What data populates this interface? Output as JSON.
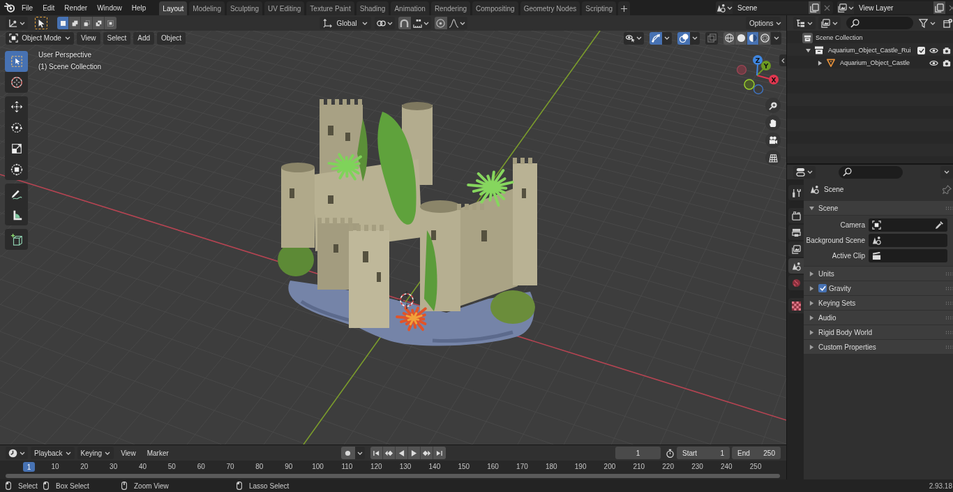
{
  "top_bar": {
    "menus": [
      "File",
      "Edit",
      "Render",
      "Window",
      "Help"
    ],
    "workspaces": [
      {
        "label": "Layout",
        "selected": true
      },
      {
        "label": "Modeling",
        "selected": false
      },
      {
        "label": "Sculpting",
        "selected": false
      },
      {
        "label": "UV Editing",
        "selected": false
      },
      {
        "label": "Texture Paint",
        "selected": false
      },
      {
        "label": "Shading",
        "selected": false
      },
      {
        "label": "Animation",
        "selected": false
      },
      {
        "label": "Rendering",
        "selected": false
      },
      {
        "label": "Compositing",
        "selected": false
      },
      {
        "label": "Geometry Nodes",
        "selected": false
      },
      {
        "label": "Scripting",
        "selected": false
      }
    ],
    "scene": "Scene",
    "view_layer": "View Layer"
  },
  "viewport": {
    "tool_header": {
      "select_modes": [
        {
          "selected": true
        },
        {
          "selected": false
        },
        {
          "selected": false
        },
        {
          "selected": false
        },
        {
          "selected": false
        }
      ],
      "orientation": "Global",
      "snap": {
        "on": false
      },
      "proportional_editing": {
        "on": false
      },
      "options": "Options"
    },
    "header": {
      "mode": "Object Mode",
      "menus": [
        "View",
        "Select",
        "Add",
        "Object"
      ],
      "gizmos": {
        "on": true
      },
      "overlays": {
        "on": true
      },
      "xray": {
        "on": false
      },
      "shading_modes": [
        {
          "selected": false
        },
        {
          "selected": false
        },
        {
          "selected": true
        },
        {
          "selected": false
        }
      ]
    },
    "info": [
      "User Perspective",
      "(1) Scene Collection"
    ],
    "tools": [
      {
        "selected": true
      },
      {
        "selected": false
      },
      {
        "selected": false
      },
      {
        "selected": false
      },
      {
        "selected": false
      },
      {
        "selected": false
      },
      {
        "selected": false
      },
      {
        "selected": false
      },
      {
        "selected": false
      }
    ],
    "gizmo_axes": [
      "X",
      "Y",
      "Z"
    ]
  },
  "outliner": {
    "tree": [
      {
        "kind": "scene_collection",
        "label": "Scene Collection",
        "children": [
          {
            "kind": "collection",
            "label": "Aquarium_Object_Castle_Rui",
            "expanded": true,
            "checked": true,
            "visible": true,
            "renderable": true,
            "children": [
              {
                "kind": "object",
                "label": "Aquarium_Object_Castle",
                "expanded": false,
                "visible": true,
                "renderable": true
              }
            ]
          }
        ]
      }
    ]
  },
  "properties": {
    "tabs": [
      {
        "selected": false
      },
      {
        "selected": false
      },
      {
        "selected": false
      },
      {
        "selected": false
      },
      {
        "selected": true
      },
      {
        "selected": false
      },
      {
        "selected": false
      }
    ],
    "context": "Scene",
    "panels": [
      {
        "title": "Scene",
        "expanded": true,
        "fields": [
          "Camera",
          "Background Scene",
          "Active Clip"
        ]
      },
      {
        "title": "Units",
        "expanded": false
      },
      {
        "title": "Gravity",
        "expanded": false,
        "toggle": {
          "checked": true
        }
      },
      {
        "title": "Keying Sets",
        "expanded": false
      },
      {
        "title": "Audio",
        "expanded": false
      },
      {
        "title": "Rigid Body World",
        "expanded": false
      },
      {
        "title": "Custom Properties",
        "expanded": false
      }
    ]
  },
  "timeline": {
    "menus": [
      {
        "label": "Playback",
        "kind": "dropdown"
      },
      {
        "label": "Keying",
        "kind": "dropdown"
      },
      {
        "label": "View",
        "kind": "menu"
      },
      {
        "label": "Marker",
        "kind": "menu"
      }
    ],
    "auto_keying": {
      "on": false
    },
    "current_frame": "1",
    "start": {
      "label": "Start",
      "value": "1"
    },
    "end": {
      "label": "End",
      "value": "250"
    },
    "playhead": "1",
    "ruler": [
      "10",
      "20",
      "30",
      "40",
      "50",
      "60",
      "70",
      "80",
      "90",
      "100",
      "110",
      "120",
      "130",
      "140",
      "150",
      "160",
      "170",
      "180",
      "190",
      "200",
      "210",
      "220",
      "230",
      "240",
      "250"
    ]
  },
  "status_bar": {
    "hints": [
      "Select",
      "Box Select",
      "Zoom View",
      "Lasso Select"
    ],
    "version": "2.93.18"
  }
}
